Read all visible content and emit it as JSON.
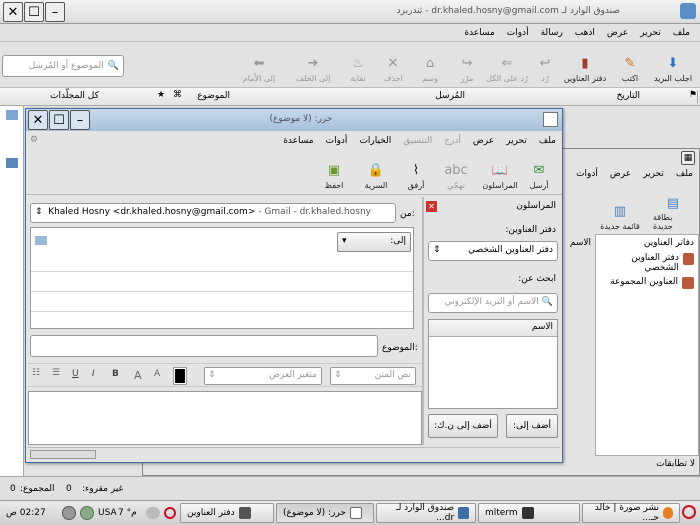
{
  "main_window": {
    "title": "صندوق الوارد لـ dr.khaled.hosny@gmail.com - ثندربرد",
    "menu": [
      "ملف",
      "تحرير",
      "عرض",
      "اذهب",
      "رسالة",
      "أدوات",
      "مساعدة"
    ],
    "toolbar": [
      {
        "label": "اجلب البريد",
        "icon": "get-mail-icon",
        "enabled": true
      },
      {
        "label": "اكتب",
        "icon": "write-icon",
        "enabled": true
      },
      {
        "label": "دفتر العناوين",
        "icon": "address-book-icon",
        "enabled": true
      },
      {
        "label": "رُد",
        "icon": "reply-icon",
        "enabled": false
      },
      {
        "label": "رُد على الكل",
        "icon": "reply-all-icon",
        "enabled": false
      },
      {
        "label": "مرّر",
        "icon": "forward-icon",
        "enabled": false
      },
      {
        "label": "وسم",
        "icon": "tag-icon",
        "enabled": false
      },
      {
        "label": "احذف",
        "icon": "delete-icon",
        "enabled": false
      },
      {
        "label": "نفاية",
        "icon": "junk-icon",
        "enabled": false
      },
      {
        "label": "إلى الخلف",
        "icon": "back-icon",
        "enabled": false
      },
      {
        "label": "إلى الأمام",
        "icon": "forward-nav-icon",
        "enabled": false
      }
    ],
    "search_placeholder": "الموضوع أو المُرسل",
    "folder_header": "كل المجلّدات",
    "columns": {
      "date": "التاريخ",
      "sender": "المُرسل",
      "subject": "الموضوع"
    },
    "status": {
      "total_label": "المجموع:",
      "total_value": "0",
      "unread_label": "غير مقروء:",
      "unread_value": "0"
    }
  },
  "address_book": {
    "menu": [
      "ملف",
      "تحرير",
      "عرض",
      "أدوات"
    ],
    "toolbar": [
      "بطاقة جديدة",
      "قائمة جديدة"
    ],
    "header": "دفاتر العناوين",
    "items": [
      "دفتر العناوين الشخصي",
      "العناوين المجموعة"
    ],
    "col_name": "الاسم",
    "status": "لا تطابقات"
  },
  "compose": {
    "title": "حرر: (لا موضوع)",
    "menu": [
      "ملف",
      "تحرير",
      "عرض",
      "أدرج",
      "التنسيق",
      "الخيارات",
      "أدوات",
      "مساعدة"
    ],
    "toolbar": [
      {
        "label": "أرسل",
        "icon": "send-icon",
        "enabled": true
      },
      {
        "label": "المراسلون",
        "icon": "contacts-icon",
        "enabled": true
      },
      {
        "label": "تهجّي",
        "icon": "spell-icon",
        "enabled": false
      },
      {
        "label": "أرفق",
        "icon": "attach-icon",
        "enabled": true
      },
      {
        "label": "السرية",
        "icon": "lock-icon",
        "enabled": true
      },
      {
        "label": "احفظ",
        "icon": "save-icon",
        "enabled": true
      }
    ],
    "contacts_sidebar": {
      "title": "المراسلون",
      "book_label": "دفتر العناوين:",
      "book_value": "دفتر العناوين الشخصي",
      "search_label": "ابحث عن:",
      "search_placeholder": "الاسم أو البريد الإلكتروني",
      "col_name": "الاسم",
      "add_to_button": "أضف إلى:",
      "add_cc_button": "أضف إلى ن.ك:"
    },
    "from_label": "من:",
    "from_value": "Khaled Hosny <dr.khaled.hosny@gmail.com>",
    "from_account": "- Gmail - dr.khaled.hosny",
    "to_label": "إلى:",
    "subject_label": "الموضوع:",
    "format_style": "نص المتن",
    "format_font": "متغير العرض",
    "bold": "B",
    "italic": "I",
    "underline": "U",
    "grow": "A",
    "shrink": "A"
  },
  "taskbar": {
    "tabs": [
      {
        "label": "نشر صورة | خالد حـ...",
        "icon": "firefox-icon",
        "active": false
      },
      {
        "label": "mlterm",
        "icon": "terminal-icon",
        "active": false
      },
      {
        "label": "صندوق الوارد لـ dr...",
        "icon": "mail-icon",
        "active": false
      },
      {
        "label": "حرر: (لا موضوع)",
        "icon": "compose-icon",
        "active": true
      },
      {
        "label": "دفتر العناوين",
        "icon": "addressbook-icon",
        "active": false
      }
    ],
    "temp": "7 °م",
    "keyboard": "USA",
    "clock": "02:27 ص"
  },
  "colors": {
    "accent": "#3a6ea5",
    "titlebar": "#b8cde4"
  }
}
